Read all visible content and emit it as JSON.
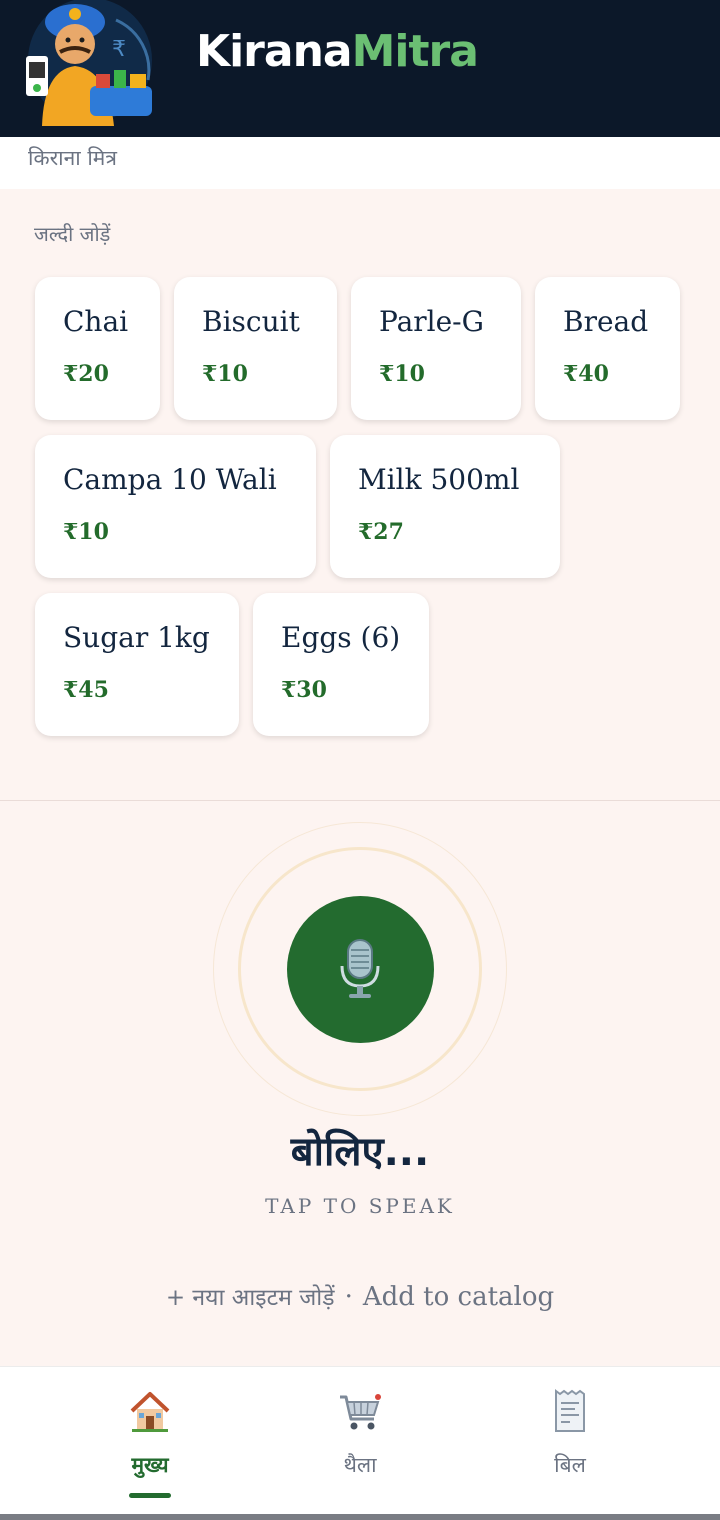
{
  "header": {
    "brand_part1": "Kirana",
    "brand_part2": "Mitra",
    "logo_icon": "shopkeeper-mascot-icon",
    "brand_color_primary": "#ffffff",
    "brand_color_accent": "#6bbf73"
  },
  "subtitle": "किराना मित्र",
  "quick_add": {
    "label": "जल्दी जोड़ें",
    "items": [
      {
        "name": "Chai",
        "price": "₹20"
      },
      {
        "name": "Biscuit",
        "price": "₹10"
      },
      {
        "name": "Parle-G",
        "price": "₹10"
      },
      {
        "name": "Bread",
        "price": "₹40"
      },
      {
        "name": "Campa 10 Wali",
        "price": "₹10"
      },
      {
        "name": "Milk 500ml",
        "price": "₹27"
      },
      {
        "name": "Sugar 1kg",
        "price": "₹45"
      },
      {
        "name": "Eggs (6)",
        "price": "₹30"
      }
    ]
  },
  "voice": {
    "icon": "microphone-icon",
    "prompt": "बोलिए...",
    "hint": "TAP TO SPEAK",
    "button_color": "#236b2f"
  },
  "add_item": {
    "hindi": "+ नया आइटम जोड़ें",
    "separator": "·",
    "english": "Add to catalog"
  },
  "bottom_nav": {
    "items": [
      {
        "label": "मुख्य",
        "icon": "home-icon",
        "active": true
      },
      {
        "label": "थैला",
        "icon": "cart-icon",
        "active": false
      },
      {
        "label": "बिल",
        "icon": "receipt-icon",
        "active": false
      }
    ]
  },
  "colors": {
    "header_bg": "#0c1829",
    "page_bg": "#fdf4f1",
    "price_green": "#236b2b",
    "text_dark": "#13263f",
    "text_muted": "#6b7382"
  }
}
